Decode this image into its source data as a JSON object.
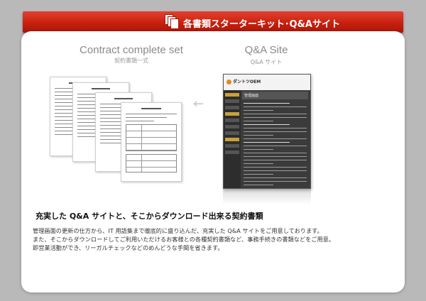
{
  "banner": {
    "title": "各書類スターターキット･Q&Aサイト",
    "icon": "documents-icon",
    "color": "#c8200e"
  },
  "contract": {
    "title": "Contract complete set",
    "subtitle": "契約書類一式"
  },
  "qa": {
    "title": "Q&A Site",
    "subtitle": "Q&A サイト",
    "site_logo": "ダントツOEM",
    "site_header": "管理画面"
  },
  "arrow_icon": "left-arrow-icon",
  "headline": "充実した Q&A サイトと、そこからダウンロード出来る契約書類",
  "body_lines": [
    "管理画面の更新の仕方から、IT 用語集まで徹底的に盛り込んだ、充実した Q&A サイトをご用意しております。",
    "また、そこからダウンロードしてご利用いただけるお客様との各種契約書類など、事務手続きの書類などをご用意。",
    "即営業活動ができ、リーガルチェックなどのめんどうな手間を省きます。"
  ]
}
